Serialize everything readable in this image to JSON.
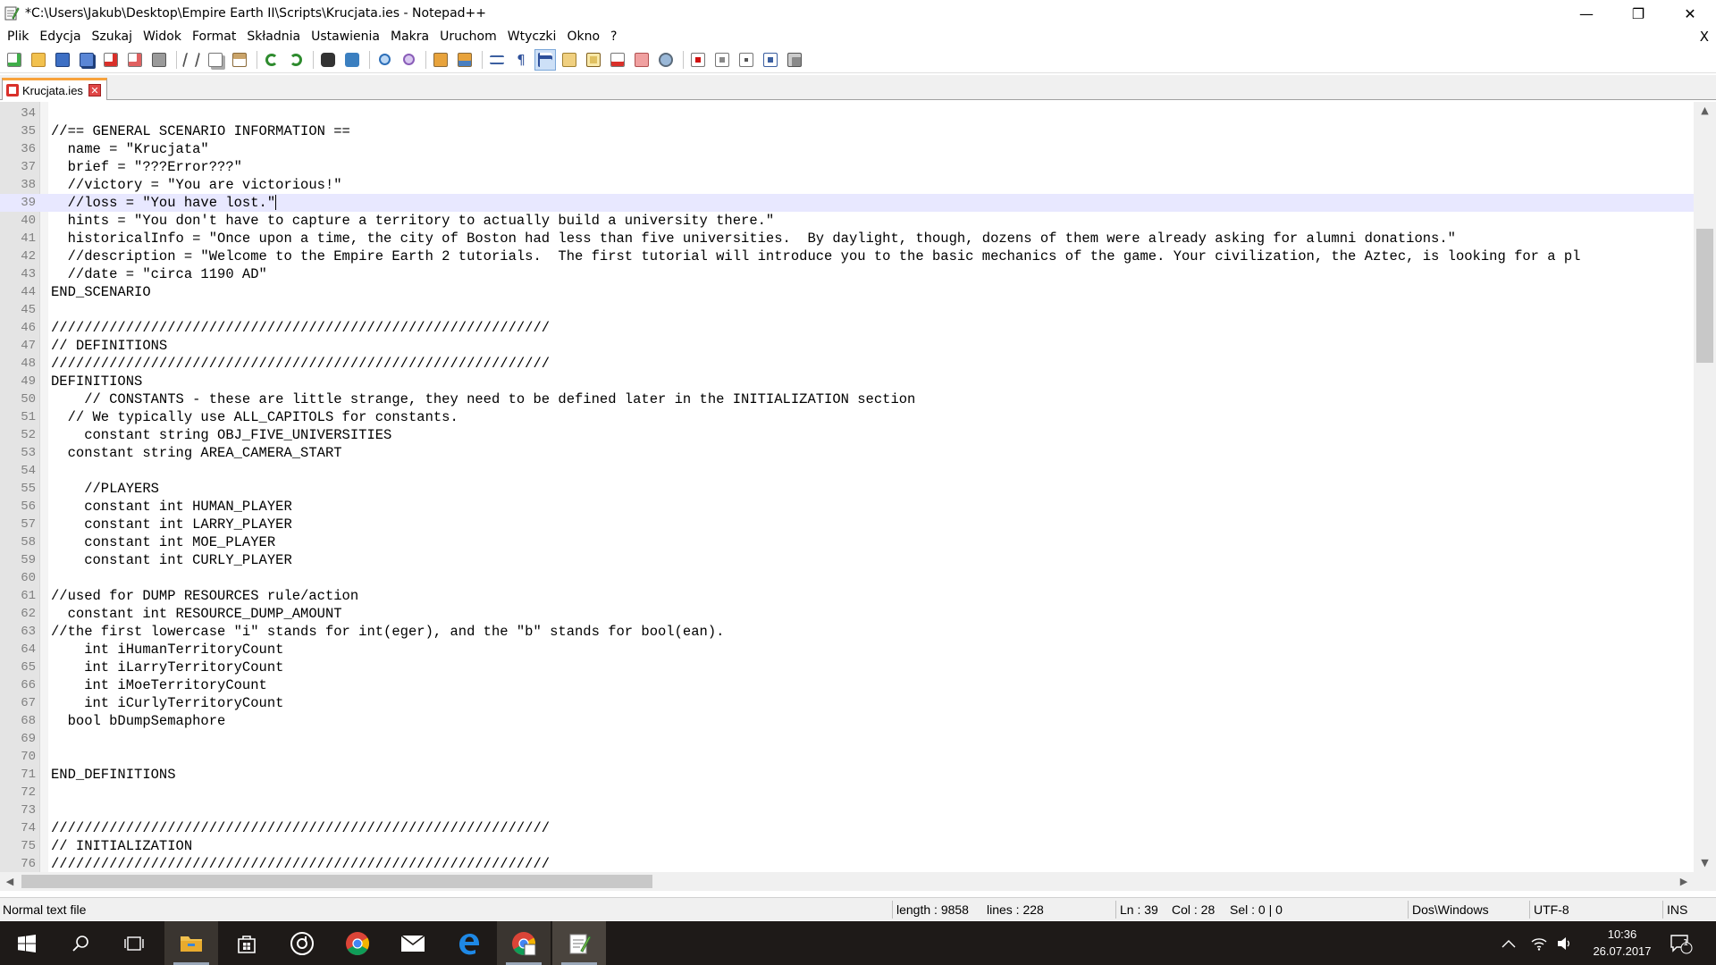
{
  "window": {
    "title": "*C:\\Users\\Jakub\\Desktop\\Empire Earth II\\Scripts\\Krucjata.ies - Notepad++",
    "minimize": "—",
    "restore": "❐",
    "close": "✕"
  },
  "menu": {
    "items": [
      "Plik",
      "Edycja",
      "Szukaj",
      "Widok",
      "Format",
      "Składnia",
      "Ustawienia",
      "Makra",
      "Uruchom",
      "Wtyczki",
      "Okno",
      "?"
    ],
    "close_doc": "X"
  },
  "toolbar": {
    "icons": [
      "new-file-icon",
      "open-file-icon",
      "save-icon",
      "save-all-icon",
      "close-icon",
      "close-all-icon",
      "print-icon",
      "cut-icon",
      "copy-icon",
      "paste-icon",
      "undo-icon",
      "redo-icon",
      "find-icon",
      "replace-icon",
      "zoom-in-icon",
      "zoom-out-icon",
      "sync-vertical-icon",
      "sync-horizontal-icon",
      "word-wrap-icon",
      "show-all-chars-icon",
      "indent-guide-icon",
      "doc-map-icon",
      "function-list-icon",
      "folder-workspace-icon",
      "doc-switcher-icon",
      "monitoring-icon",
      "record-macro-icon",
      "stop-macro-icon",
      "play-macro-icon",
      "run-macro-multiple-icon",
      "save-macro-icon"
    ]
  },
  "tab": {
    "label": "Krucjata.ies",
    "close": "✕"
  },
  "editor": {
    "current_line": 39,
    "lines": [
      {
        "n": "34",
        "t": ""
      },
      {
        "n": "35",
        "t": "//== GENERAL SCENARIO INFORMATION =="
      },
      {
        "n": "36",
        "t": "  name = \"Krucjata\""
      },
      {
        "n": "37",
        "t": "  brief = \"???Error???\""
      },
      {
        "n": "38",
        "t": "  //victory = \"You are victorious!\""
      },
      {
        "n": "39",
        "t": "  //loss = \"You have lost.\""
      },
      {
        "n": "40",
        "t": "  hints = \"You don't have to capture a territory to actually build a university there.\""
      },
      {
        "n": "41",
        "t": "  historicalInfo = \"Once upon a time, the city of Boston had less than five universities.  By daylight, though, dozens of them were already asking for alumni donations.\""
      },
      {
        "n": "42",
        "t": "  //description = \"Welcome to the Empire Earth 2 tutorials.  The first tutorial will introduce you to the basic mechanics of the game. Your civilization, the Aztec, is looking for a pl"
      },
      {
        "n": "43",
        "t": "  //date = \"circa 1190 AD\""
      },
      {
        "n": "44",
        "t": "END_SCENARIO"
      },
      {
        "n": "45",
        "t": ""
      },
      {
        "n": "46",
        "t": "////////////////////////////////////////////////////////////"
      },
      {
        "n": "47",
        "t": "// DEFINITIONS"
      },
      {
        "n": "48",
        "t": "////////////////////////////////////////////////////////////"
      },
      {
        "n": "49",
        "t": "DEFINITIONS"
      },
      {
        "n": "50",
        "t": "    // CONSTANTS - these are little strange, they need to be defined later in the INITIALIZATION section"
      },
      {
        "n": "51",
        "t": "  // We typically use ALL_CAPITOLS for constants."
      },
      {
        "n": "52",
        "t": "    constant string OBJ_FIVE_UNIVERSITIES"
      },
      {
        "n": "53",
        "t": "  constant string AREA_CAMERA_START"
      },
      {
        "n": "54",
        "t": ""
      },
      {
        "n": "55",
        "t": "    //PLAYERS"
      },
      {
        "n": "56",
        "t": "    constant int HUMAN_PLAYER"
      },
      {
        "n": "57",
        "t": "    constant int LARRY_PLAYER"
      },
      {
        "n": "58",
        "t": "    constant int MOE_PLAYER"
      },
      {
        "n": "59",
        "t": "    constant int CURLY_PLAYER"
      },
      {
        "n": "60",
        "t": ""
      },
      {
        "n": "61",
        "t": "//used for DUMP RESOURCES rule/action"
      },
      {
        "n": "62",
        "t": "  constant int RESOURCE_DUMP_AMOUNT"
      },
      {
        "n": "63",
        "t": "//the first lowercase \"i\" stands for int(eger), and the \"b\" stands for bool(ean)."
      },
      {
        "n": "64",
        "t": "    int iHumanTerritoryCount"
      },
      {
        "n": "65",
        "t": "    int iLarryTerritoryCount"
      },
      {
        "n": "66",
        "t": "    int iMoeTerritoryCount"
      },
      {
        "n": "67",
        "t": "    int iCurlyTerritoryCount"
      },
      {
        "n": "68",
        "t": "  bool bDumpSemaphore"
      },
      {
        "n": "69",
        "t": ""
      },
      {
        "n": "70",
        "t": ""
      },
      {
        "n": "71",
        "t": "END_DEFINITIONS"
      },
      {
        "n": "72",
        "t": ""
      },
      {
        "n": "73",
        "t": ""
      },
      {
        "n": "74",
        "t": "////////////////////////////////////////////////////////////"
      },
      {
        "n": "75",
        "t": "// INITIALIZATION"
      },
      {
        "n": "76",
        "t": "////////////////////////////////////////////////////////////"
      }
    ]
  },
  "statusbar": {
    "file_type": "Normal text file",
    "length": "length : 9858",
    "lines": "lines : 228",
    "ln": "Ln : 39",
    "col": "Col : 28",
    "sel": "Sel : 0 | 0",
    "eol": "Dos\\Windows",
    "encoding": "UTF-8",
    "mode": "INS"
  },
  "taskbar": {
    "apps": [
      "start-icon",
      "search-icon",
      "task-view-icon",
      "file-explorer-icon",
      "store-icon",
      "groove-icon",
      "chrome-icon",
      "mail-icon",
      "edge-icon",
      "chrome-alt-icon",
      "notepadpp-icon"
    ],
    "time": "10:36",
    "date": "26.07.2017",
    "notifications": "1"
  }
}
